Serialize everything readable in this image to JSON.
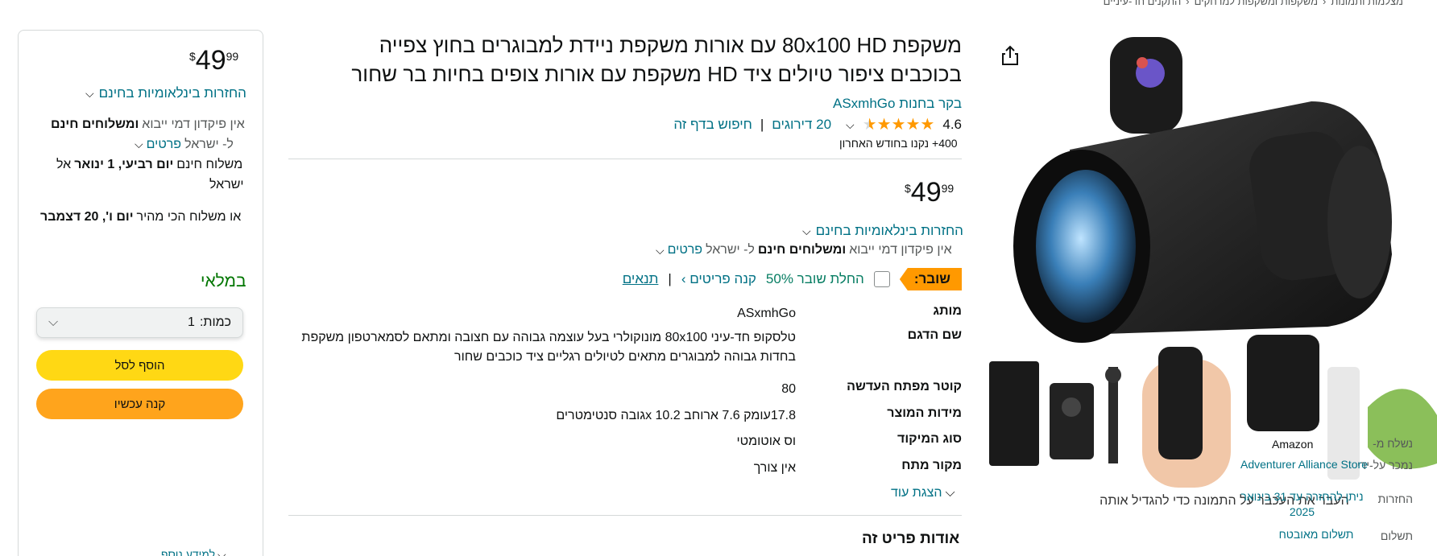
{
  "breadcrumb": [
    "התקנים חד-עיניים",
    "משקפות ומשקפות למרחקים",
    "מצלמות ותמונות"
  ],
  "image": {
    "hover_hint": "העבר את העכבר על התמונה כדי להגדיל אותה"
  },
  "product": {
    "title_line1": "משקפת 80x100 HD עם אורות משקפת ניידת למבוגרים בחוץ צפייה",
    "title_line2": "בכוכבים ציפור טיולים ציד HD משקפת עם אורות צופים בחיות בר שחור",
    "store_link": "בקר בחנות ASxmhGo",
    "rating": "4.6",
    "ratings_count": "20 דירוגים",
    "search_page": "חיפוש בדף זה",
    "bought": "400+ נקנו בחודש האחרון"
  },
  "price": {
    "currency": "$",
    "whole": "49",
    "fraction": "99"
  },
  "center": {
    "free_returns": "החזרות בינלאומיות בחינם",
    "import_fees": "אין פיקדון דמי ייבוא",
    "free_shipping_bold": "ומשלוחים חינם",
    "to_israel": "ל- ישראל",
    "details": "פרטים",
    "coupon_badge": "שובר:",
    "coupon_apply": "החלת שובר 50%",
    "shop_items": "קנה פריטים ›",
    "terms": "תנאים",
    "show_more": "הצגת עוד",
    "about": "אודות פריט זה"
  },
  "specs": [
    {
      "key": "מותג",
      "value": "ASxmhGo"
    },
    {
      "key": "שם הדגם",
      "value": "טלסקופ חד-עיני 80x100 מונוקולרי בעל עוצמה גבוהה עם חצובה ומתאם לסמארטפון משקפת בחדות גבוהה למבוגרים מתאים לטיולים רגליים ציד כוכבים שחור"
    },
    {
      "key": "קוטר מפתח העדשה",
      "value": "80"
    },
    {
      "key": "מידות המוצר",
      "value": "17.8עומק 7.6 ארוחב 10.2 xגובה סנטימטרים"
    },
    {
      "key": "סוג המיקוד",
      "value": "וס אוטומטי"
    },
    {
      "key": "מקור מתח",
      "value": "אין צורך"
    }
  ],
  "buybox": {
    "free_returns": "החזרות בינלאומיות בחינם",
    "import_line_a": "אין פיקדון דמי ייבוא",
    "import_line_b": "ומשלוחים חינם",
    "to_israel": "ל- ישראל",
    "details": "פרטים",
    "delivery_prefix": "משלוח חינם",
    "delivery_date": "יום רביעי, 1 ינואר",
    "delivery_suffix": "אל",
    "delivery_country": "ישראל",
    "fastest_prefix": "או משלוח הכי מהיר",
    "fastest_date": "יום ו', 20 דצמבר",
    "in_stock": "במלאי",
    "qty_label": "כמות:",
    "qty_value": "1",
    "add_to_cart": "הוסף לסל",
    "buy_now": "קנה עכשיו",
    "ships_from_label": "נשלח מ-",
    "ships_from": "Amazon",
    "sold_by_label": "נמכר על-ידי",
    "sold_by": "Adventurer Alliance Store",
    "returns_label": "החזרות",
    "returns": "ניתן להחזרה עד 31 בינואר 2025",
    "payment_label": "תשלום",
    "payment": "תשלום מאובטח",
    "see_more": "למידע נוסף"
  },
  "colors": {
    "link": "#007185",
    "coupon_badge": "#ff9900",
    "add_to_cart": "#ffd814",
    "buy_now": "#ffa41c",
    "in_stock": "#007600",
    "star": "#ff9900"
  }
}
